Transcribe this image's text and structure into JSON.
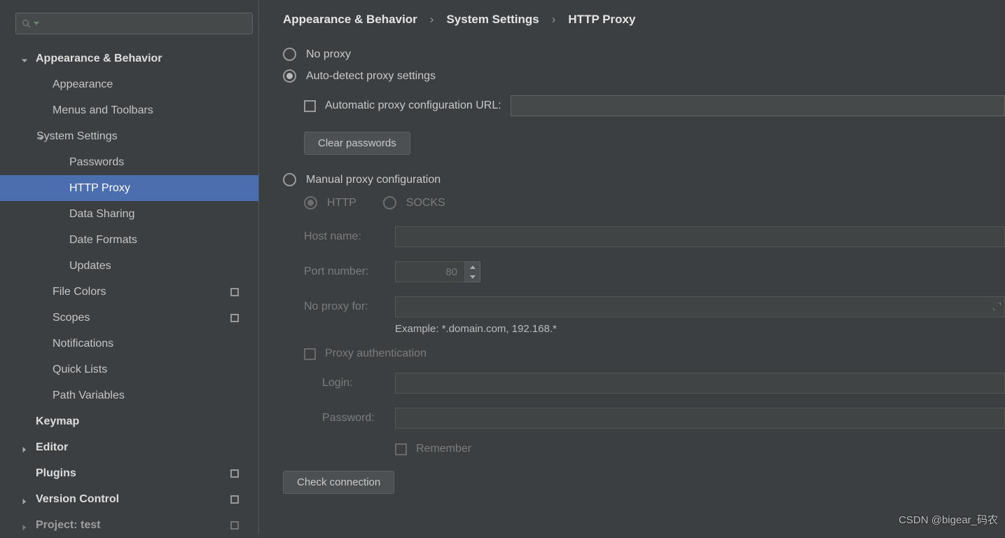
{
  "breadcrumb": [
    "Appearance & Behavior",
    "System Settings",
    "HTTP Proxy"
  ],
  "sidebar": {
    "items": [
      {
        "label": "Appearance & Behavior",
        "lvl": 0,
        "expanded": true
      },
      {
        "label": "Appearance",
        "lvl": 1
      },
      {
        "label": "Menus and Toolbars",
        "lvl": 1
      },
      {
        "label": "System Settings",
        "lvl": 1,
        "parent": true,
        "expanded": true
      },
      {
        "label": "Passwords",
        "lvl": 2
      },
      {
        "label": "HTTP Proxy",
        "lvl": 2,
        "selected": true
      },
      {
        "label": "Data Sharing",
        "lvl": 2
      },
      {
        "label": "Date Formats",
        "lvl": 2
      },
      {
        "label": "Updates",
        "lvl": 2
      },
      {
        "label": "File Colors",
        "lvl": 1,
        "badge": true
      },
      {
        "label": "Scopes",
        "lvl": 1,
        "badge": true
      },
      {
        "label": "Notifications",
        "lvl": 1
      },
      {
        "label": "Quick Lists",
        "lvl": 1
      },
      {
        "label": "Path Variables",
        "lvl": 1
      },
      {
        "label": "Keymap",
        "lvl": 0,
        "leaf": true
      },
      {
        "label": "Editor",
        "lvl": 0,
        "collapsed": true
      },
      {
        "label": "Plugins",
        "lvl": 0,
        "leaf": true,
        "badge": true
      },
      {
        "label": "Version Control",
        "lvl": 0,
        "collapsed": true,
        "badge": true
      },
      {
        "label": "Project: test",
        "lvl": 0,
        "collapsed": true,
        "badge": true,
        "cut": true
      }
    ]
  },
  "proxy": {
    "no_proxy": "No proxy",
    "auto": "Auto-detect proxy settings",
    "pac_label": "Automatic proxy configuration URL:",
    "clear": "Clear passwords",
    "manual": "Manual proxy configuration",
    "http": "HTTP",
    "socks": "SOCKS",
    "host_label": "Host name:",
    "host_value": "",
    "port_label": "Port number:",
    "port_value": "80",
    "noproxy_label": "No proxy for:",
    "noproxy_value": "",
    "example": "Example: *.domain.com, 192.168.*",
    "auth": "Proxy authentication",
    "login_label": "Login:",
    "login_value": "",
    "pass_label": "Password:",
    "pass_value": "",
    "remember": "Remember",
    "check": "Check connection"
  },
  "watermark": "CSDN @bigear_码农"
}
